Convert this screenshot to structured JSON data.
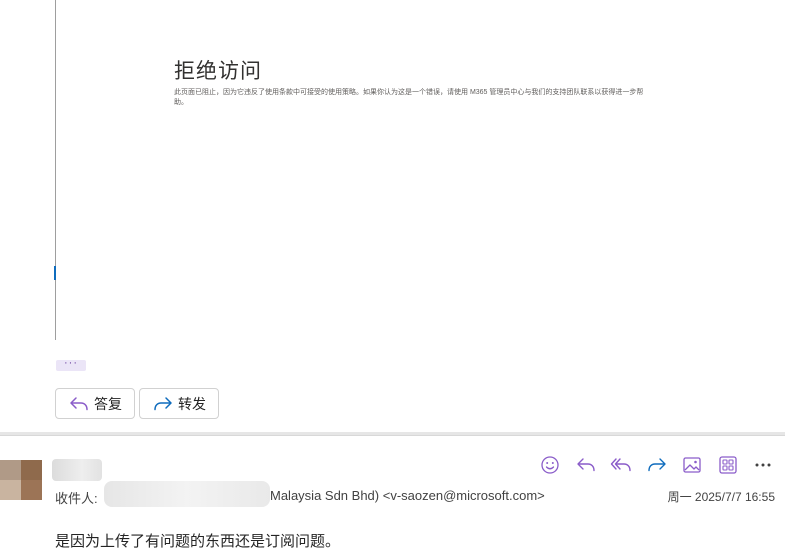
{
  "blocked_page": {
    "title": "拒绝访问",
    "message": "此页面已阻止，因为它违反了使用条款中可接受的使用策略。如果你认为这是一个错误，请使用 M365 管理员中心与我们的支持团队联系以获得进一步帮助。"
  },
  "thread": {
    "more_label": "···",
    "reply_label": "答复",
    "forward_label": "转发"
  },
  "message": {
    "to_label": "收件人:",
    "to_visible_text": "Malaysia Sdn Bhd) <v-saozen@microsoft.com>",
    "date": "周一 2025/7/7 16:55",
    "body": "是因为上传了有问题的东西还是订阅问题。"
  },
  "toolbar_icons": [
    "emoji-icon",
    "reply-icon",
    "reply-all-icon",
    "forward-icon",
    "image-icon",
    "apps-icon",
    "more-icon"
  ],
  "colors": {
    "accent": "#8a5cc9",
    "text": "#242424"
  }
}
